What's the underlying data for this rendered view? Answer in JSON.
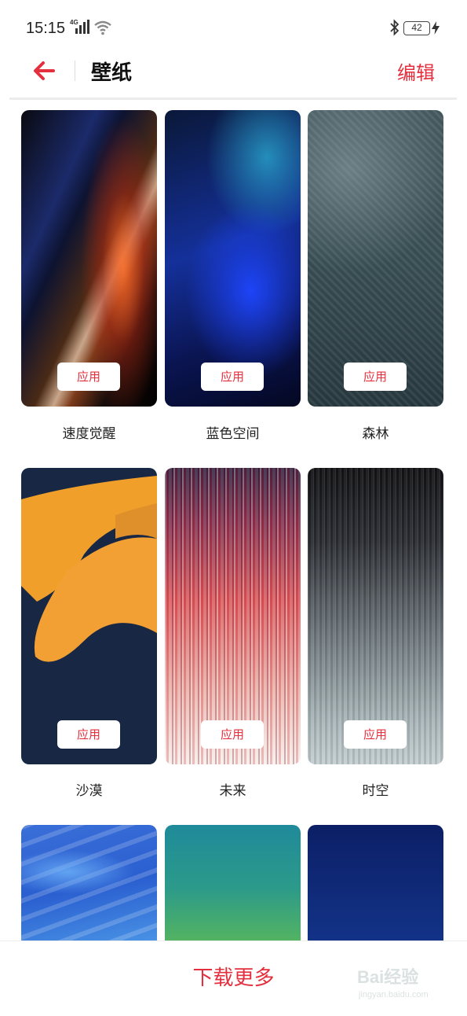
{
  "status_bar": {
    "time": "15:15",
    "network": "4G",
    "battery": "42"
  },
  "header": {
    "title": "壁纸",
    "edit_label": "编辑"
  },
  "wallpapers": [
    {
      "name": "速度觉醒",
      "apply_label": "应用"
    },
    {
      "name": "蓝色空间",
      "apply_label": "应用"
    },
    {
      "name": "森林",
      "apply_label": "应用"
    },
    {
      "name": "沙漠",
      "apply_label": "应用"
    },
    {
      "name": "未来",
      "apply_label": "应用"
    },
    {
      "name": "时空",
      "apply_label": "应用"
    }
  ],
  "footer": {
    "download_more": "下载更多"
  },
  "watermark": {
    "brand": "Bai经验",
    "url": "jingyan.baidu.com"
  },
  "colors": {
    "accent": "#e4303e"
  }
}
